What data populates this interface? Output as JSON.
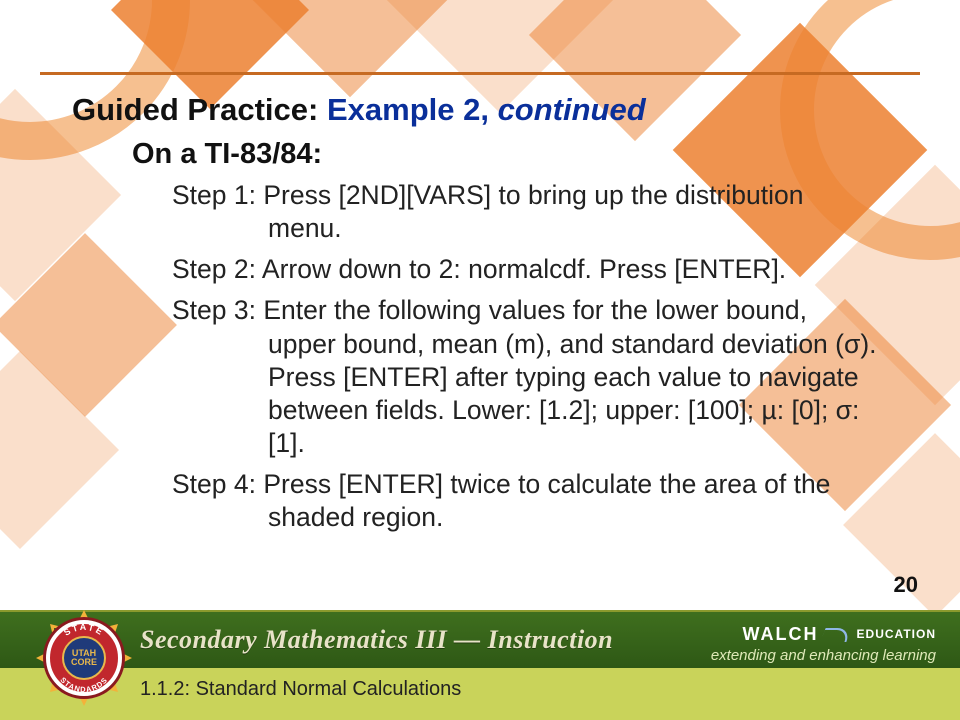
{
  "title": {
    "prefix": "Guided Practice: ",
    "example": "Example 2, ",
    "continued": "continued"
  },
  "device_heading": "On a TI-83/84:",
  "steps": [
    {
      "label": "Step 1:",
      "body": "Press [2ND][VARS] to bring up the distribution menu."
    },
    {
      "label": "Step 2:",
      "body": "Arrow down to 2: normalcdf. Press [ENTER]."
    },
    {
      "label": "Step 3:",
      "body": "Enter the following values for the lower bound, upper bound, mean (m), and standard deviation (σ). Press [ENTER] after typing each value to navigate between fields. Lower: [1.2]; upper: [100]; µ: [0]; σ: [1]."
    },
    {
      "label": "Step 4:",
      "body": "Press [ENTER] twice to calculate the area of the shaded region."
    }
  ],
  "page_number": "20",
  "footer": {
    "course_title": "Secondary Mathematics III — Instruction",
    "subtitle": "1.1.2: Standard Normal Calculations",
    "brand_main": "WALCH",
    "brand_sub": "EDUCATION",
    "tagline": "extending and enhancing learning"
  },
  "seal": {
    "top_arc": "STATE",
    "center": "UTAH CORE",
    "bottom_arc": "STANDARDS"
  },
  "colors": {
    "accent_orange": "#e77b2f",
    "title_blue": "#0a2f9a",
    "footer_green": "#3f6f1e",
    "footer_lime": "#c9d35a"
  }
}
